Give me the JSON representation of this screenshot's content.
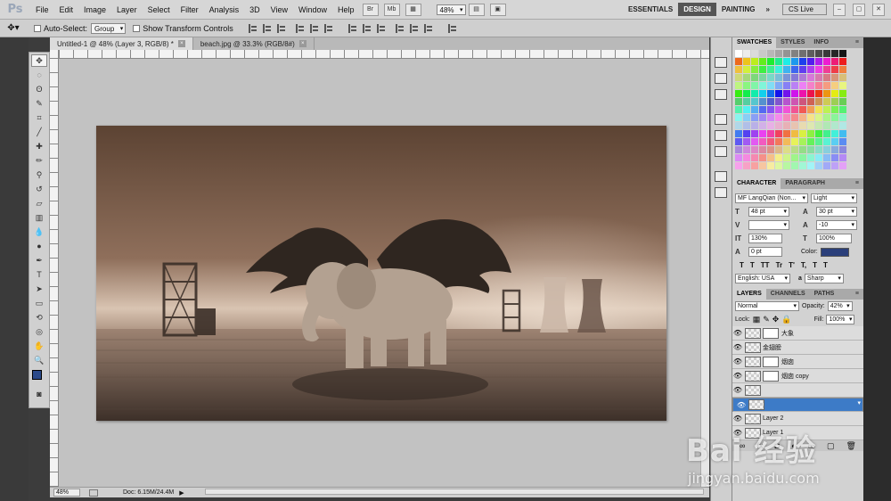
{
  "app": {
    "logo": "Ps"
  },
  "menu": [
    "File",
    "Edit",
    "Image",
    "Layer",
    "Select",
    "Filter",
    "Analysis",
    "3D",
    "View",
    "Window",
    "Help"
  ],
  "menubar_buttons": [
    "Br",
    "Mb"
  ],
  "zoom_select": "48%",
  "workspaces": [
    {
      "label": "ESSENTIALS",
      "active": false
    },
    {
      "label": "DESIGN",
      "active": true
    },
    {
      "label": "PAINTING",
      "active": false
    }
  ],
  "workspace_more": "»",
  "cslive": "CS Live",
  "options": {
    "auto_select_label": "Auto-Select:",
    "auto_select_value": "Group",
    "show_transform": "Show Transform Controls"
  },
  "tabs": [
    {
      "label": "Untitled-1 @ 48% (Layer 3, RGB/8) *",
      "active": true
    },
    {
      "label": "beach.jpg @ 33.3% (RGB/8#)",
      "active": false
    }
  ],
  "status": {
    "zoom": "48%",
    "doc": "Doc: 6.15M/24.4M"
  },
  "swatches_tabs": [
    "SWATCHES",
    "STYLES",
    "INFO"
  ],
  "character_tabs": [
    "CHARACTER",
    "PARAGRAPH"
  ],
  "character": {
    "font_family": "MF LangQian (Non...",
    "font_style": "Light",
    "size": "48 pt",
    "leading": "30 pt",
    "tracking": "-10",
    "vscale": "130%",
    "hscale": "100%",
    "baseline": "0 pt",
    "color_label": "Color:",
    "color": "#2b3f7a",
    "language": "English: USA",
    "aa_label": "a",
    "antialias": "Sharp",
    "style_buttons": [
      "T",
      "T",
      "TT",
      "Tr",
      "T'",
      "T,",
      "T",
      "T"
    ]
  },
  "layers_tabs": [
    "LAYERS",
    "CHANNELS",
    "PATHS"
  ],
  "layers_panel": {
    "blend": "Normal",
    "opacity_label": "Opacity:",
    "opacity": "42%",
    "lock_label": "Lock:",
    "fill_label": "Fill:",
    "fill": "100%",
    "layers": [
      {
        "name": "大象",
        "selected": false,
        "mask": true
      },
      {
        "name": "金翅膀",
        "selected": false,
        "mask": false
      },
      {
        "name": "烟囱",
        "selected": false,
        "mask": true
      },
      {
        "name": "烟囱 copy",
        "selected": false,
        "mask": true
      },
      {
        "name": "",
        "selected": false,
        "mask": false
      },
      {
        "name": "",
        "selected": true,
        "mask": false
      },
      {
        "name": "Layer 2",
        "selected": false,
        "mask": false
      },
      {
        "name": "Layer 1",
        "selected": false,
        "mask": false
      }
    ],
    "footer_icons": [
      "link-icon",
      "fx-icon",
      "mask-icon",
      "adjustment-icon",
      "folder-icon",
      "new-layer-icon",
      "trash-icon"
    ]
  },
  "watermark": {
    "logo": "Bai 经验",
    "url": "jingyan.baidu.com"
  },
  "colors": {
    "fg": "#2b4a8a",
    "bg": "#ffffff",
    "accent": "#3d7bc7"
  }
}
